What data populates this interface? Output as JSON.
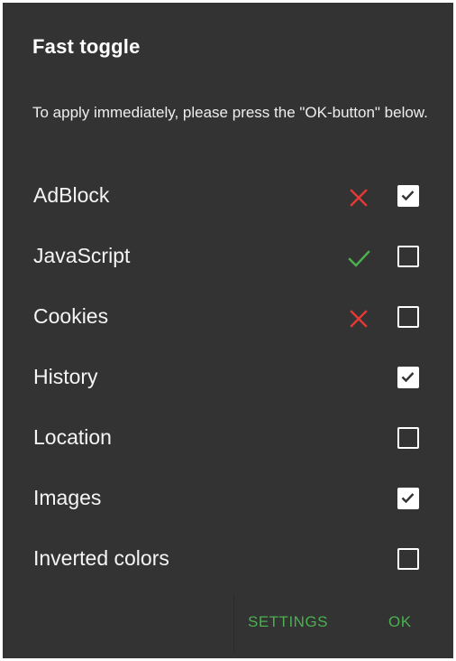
{
  "dialog": {
    "title": "Fast toggle",
    "message": "To apply immediately, please press the \"OK-button\" below."
  },
  "items": [
    {
      "label": "AdBlock",
      "status": "cross-icon",
      "checked": true
    },
    {
      "label": "JavaScript",
      "status": "check-icon",
      "checked": false
    },
    {
      "label": "Cookies",
      "status": "cross-icon",
      "checked": false
    },
    {
      "label": "History",
      "status": "",
      "checked": true
    },
    {
      "label": "Location",
      "status": "",
      "checked": false
    },
    {
      "label": "Images",
      "status": "",
      "checked": true
    },
    {
      "label": "Inverted colors",
      "status": "",
      "checked": false
    }
  ],
  "buttons": {
    "settings": "SETTINGS",
    "ok": "OK"
  },
  "colors": {
    "background": "#333333",
    "accent": "#4caf50",
    "error": "#e53935",
    "text": "#ffffff"
  }
}
